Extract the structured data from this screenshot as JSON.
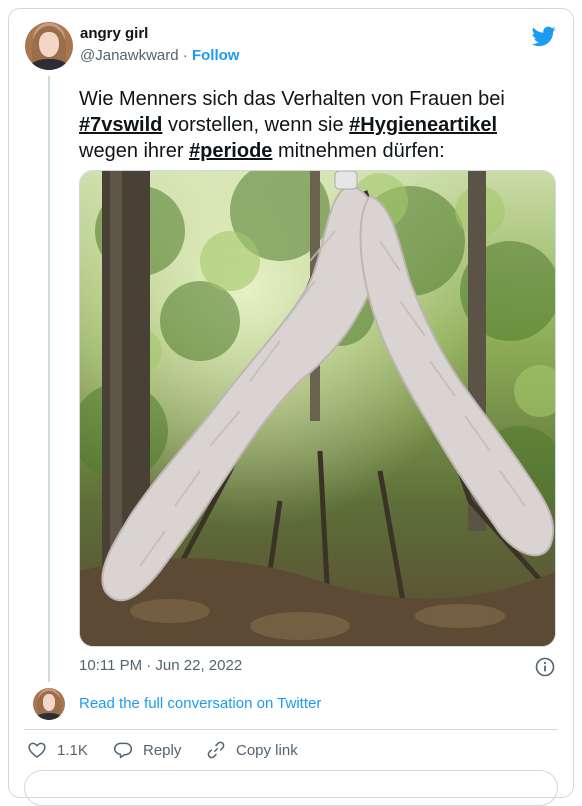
{
  "author": {
    "display_name": "angry girl",
    "handle": "@Janawkward",
    "separator": "·",
    "follow_label": "Follow"
  },
  "tweet": {
    "text_1": "Wie Menners sich das Verhalten von Frauen bei ",
    "hashtag_1": "#7vswild",
    "text_2": " vorstellen, wenn sie ",
    "hashtag_2": "#Hygieneartikel",
    "text_3": " wegen ihrer ",
    "hashtag_3": "#periode",
    "text_4": " mitnehmen dürfen:"
  },
  "meta": {
    "timestamp": "10:11 PM · Jun 22, 2022"
  },
  "conversation_link": "Read the full conversation on Twitter",
  "actions": {
    "like_count": "1.1K",
    "reply_label": "Reply",
    "copy_link_label": "Copy link"
  },
  "icons": {
    "brand": "twitter-bird-icon",
    "info": "info-icon",
    "like": "heart-icon",
    "reply": "reply-icon",
    "copy": "link-icon"
  },
  "colors": {
    "accent": "#1d9bf0",
    "text": "#0f1419",
    "secondary_text": "#536471",
    "border": "#cfd9de"
  }
}
